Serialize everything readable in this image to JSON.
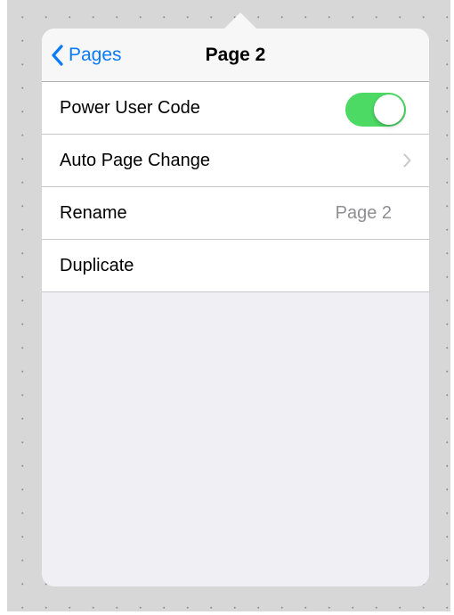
{
  "navbar": {
    "back_label": "Pages",
    "title": "Page 2"
  },
  "rows": [
    {
      "label": "Power User Code",
      "toggle_on": true
    },
    {
      "label": "Auto Page Change"
    },
    {
      "label": "Rename",
      "value": "Page 2"
    },
    {
      "label": "Duplicate"
    }
  ],
  "colors": {
    "accent": "#0a7aff",
    "toggle_on": "#4cd964",
    "secondary_text": "#8e8e93",
    "background": "#efeff4"
  },
  "icons": {
    "back": "chevron-left-icon",
    "disclosure": "chevron-right-icon"
  }
}
